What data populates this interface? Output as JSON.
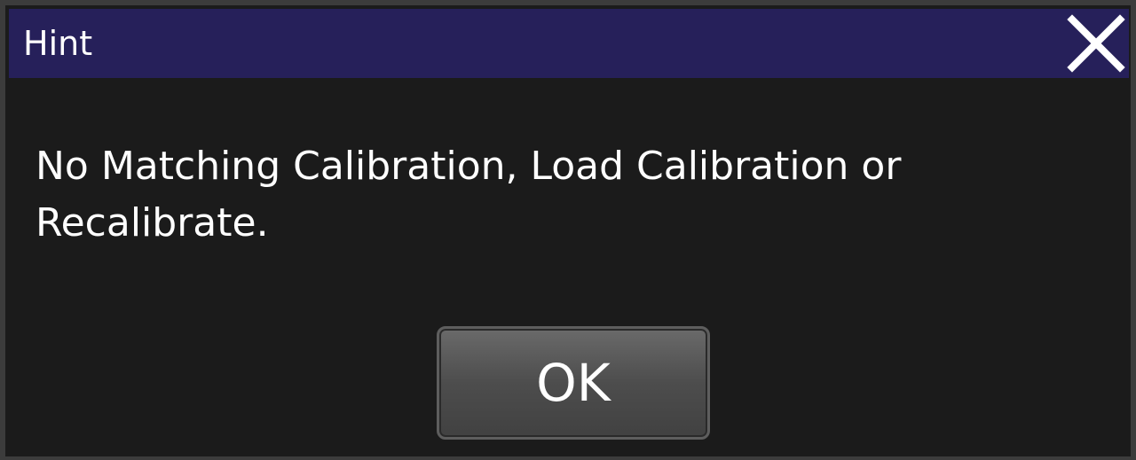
{
  "dialog": {
    "title": "Hint",
    "close_icon": "close-icon",
    "message_line1": "No Matching Calibration, Load Calibration or",
    "message_line2": "Recalibrate.",
    "ok_label": "OK"
  },
  "colors": {
    "titlebar": "#26205a",
    "background": "#1b1b1b",
    "text": "#ffffff",
    "button": "#4d4d4d"
  }
}
